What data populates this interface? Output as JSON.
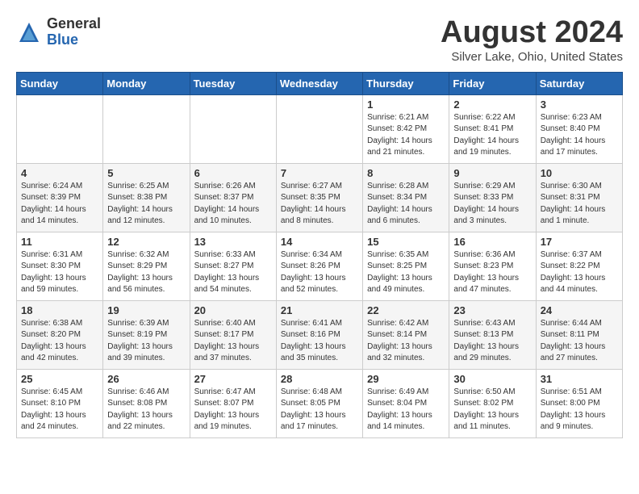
{
  "logo": {
    "general": "General",
    "blue": "Blue"
  },
  "title": {
    "month": "August 2024",
    "location": "Silver Lake, Ohio, United States"
  },
  "weekdays": [
    "Sunday",
    "Monday",
    "Tuesday",
    "Wednesday",
    "Thursday",
    "Friday",
    "Saturday"
  ],
  "weeks": [
    [
      {
        "day": "",
        "info": ""
      },
      {
        "day": "",
        "info": ""
      },
      {
        "day": "",
        "info": ""
      },
      {
        "day": "",
        "info": ""
      },
      {
        "day": "1",
        "info": "Sunrise: 6:21 AM\nSunset: 8:42 PM\nDaylight: 14 hours\nand 21 minutes."
      },
      {
        "day": "2",
        "info": "Sunrise: 6:22 AM\nSunset: 8:41 PM\nDaylight: 14 hours\nand 19 minutes."
      },
      {
        "day": "3",
        "info": "Sunrise: 6:23 AM\nSunset: 8:40 PM\nDaylight: 14 hours\nand 17 minutes."
      }
    ],
    [
      {
        "day": "4",
        "info": "Sunrise: 6:24 AM\nSunset: 8:39 PM\nDaylight: 14 hours\nand 14 minutes."
      },
      {
        "day": "5",
        "info": "Sunrise: 6:25 AM\nSunset: 8:38 PM\nDaylight: 14 hours\nand 12 minutes."
      },
      {
        "day": "6",
        "info": "Sunrise: 6:26 AM\nSunset: 8:37 PM\nDaylight: 14 hours\nand 10 minutes."
      },
      {
        "day": "7",
        "info": "Sunrise: 6:27 AM\nSunset: 8:35 PM\nDaylight: 14 hours\nand 8 minutes."
      },
      {
        "day": "8",
        "info": "Sunrise: 6:28 AM\nSunset: 8:34 PM\nDaylight: 14 hours\nand 6 minutes."
      },
      {
        "day": "9",
        "info": "Sunrise: 6:29 AM\nSunset: 8:33 PM\nDaylight: 14 hours\nand 3 minutes."
      },
      {
        "day": "10",
        "info": "Sunrise: 6:30 AM\nSunset: 8:31 PM\nDaylight: 14 hours\nand 1 minute."
      }
    ],
    [
      {
        "day": "11",
        "info": "Sunrise: 6:31 AM\nSunset: 8:30 PM\nDaylight: 13 hours\nand 59 minutes."
      },
      {
        "day": "12",
        "info": "Sunrise: 6:32 AM\nSunset: 8:29 PM\nDaylight: 13 hours\nand 56 minutes."
      },
      {
        "day": "13",
        "info": "Sunrise: 6:33 AM\nSunset: 8:27 PM\nDaylight: 13 hours\nand 54 minutes."
      },
      {
        "day": "14",
        "info": "Sunrise: 6:34 AM\nSunset: 8:26 PM\nDaylight: 13 hours\nand 52 minutes."
      },
      {
        "day": "15",
        "info": "Sunrise: 6:35 AM\nSunset: 8:25 PM\nDaylight: 13 hours\nand 49 minutes."
      },
      {
        "day": "16",
        "info": "Sunrise: 6:36 AM\nSunset: 8:23 PM\nDaylight: 13 hours\nand 47 minutes."
      },
      {
        "day": "17",
        "info": "Sunrise: 6:37 AM\nSunset: 8:22 PM\nDaylight: 13 hours\nand 44 minutes."
      }
    ],
    [
      {
        "day": "18",
        "info": "Sunrise: 6:38 AM\nSunset: 8:20 PM\nDaylight: 13 hours\nand 42 minutes."
      },
      {
        "day": "19",
        "info": "Sunrise: 6:39 AM\nSunset: 8:19 PM\nDaylight: 13 hours\nand 39 minutes."
      },
      {
        "day": "20",
        "info": "Sunrise: 6:40 AM\nSunset: 8:17 PM\nDaylight: 13 hours\nand 37 minutes."
      },
      {
        "day": "21",
        "info": "Sunrise: 6:41 AM\nSunset: 8:16 PM\nDaylight: 13 hours\nand 35 minutes."
      },
      {
        "day": "22",
        "info": "Sunrise: 6:42 AM\nSunset: 8:14 PM\nDaylight: 13 hours\nand 32 minutes."
      },
      {
        "day": "23",
        "info": "Sunrise: 6:43 AM\nSunset: 8:13 PM\nDaylight: 13 hours\nand 29 minutes."
      },
      {
        "day": "24",
        "info": "Sunrise: 6:44 AM\nSunset: 8:11 PM\nDaylight: 13 hours\nand 27 minutes."
      }
    ],
    [
      {
        "day": "25",
        "info": "Sunrise: 6:45 AM\nSunset: 8:10 PM\nDaylight: 13 hours\nand 24 minutes."
      },
      {
        "day": "26",
        "info": "Sunrise: 6:46 AM\nSunset: 8:08 PM\nDaylight: 13 hours\nand 22 minutes."
      },
      {
        "day": "27",
        "info": "Sunrise: 6:47 AM\nSunset: 8:07 PM\nDaylight: 13 hours\nand 19 minutes."
      },
      {
        "day": "28",
        "info": "Sunrise: 6:48 AM\nSunset: 8:05 PM\nDaylight: 13 hours\nand 17 minutes."
      },
      {
        "day": "29",
        "info": "Sunrise: 6:49 AM\nSunset: 8:04 PM\nDaylight: 13 hours\nand 14 minutes."
      },
      {
        "day": "30",
        "info": "Sunrise: 6:50 AM\nSunset: 8:02 PM\nDaylight: 13 hours\nand 11 minutes."
      },
      {
        "day": "31",
        "info": "Sunrise: 6:51 AM\nSunset: 8:00 PM\nDaylight: 13 hours\nand 9 minutes."
      }
    ]
  ]
}
